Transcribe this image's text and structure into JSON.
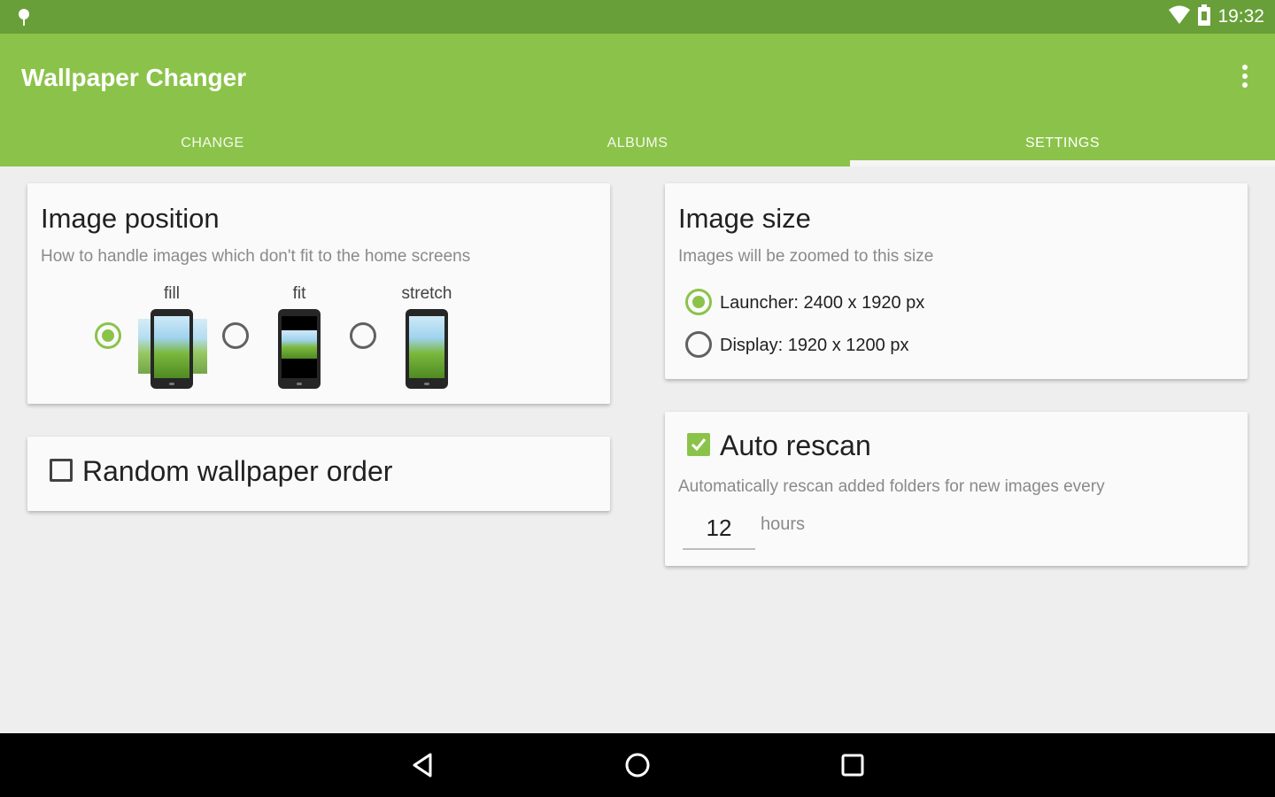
{
  "status_bar": {
    "time": "19:32",
    "icons": [
      "notification-pin-icon",
      "wifi-icon",
      "battery-icon"
    ]
  },
  "app_bar": {
    "title": "Wallpaper Changer",
    "menu_icon": "overflow-menu-icon"
  },
  "tabs": [
    {
      "label": "CHANGE",
      "active": false
    },
    {
      "label": "ALBUMS",
      "active": false
    },
    {
      "label": "SETTINGS",
      "active": true
    }
  ],
  "image_position": {
    "title": "Image position",
    "subtitle": "How to handle images which don't fit to the home screens",
    "options": [
      {
        "label": "fill",
        "selected": true
      },
      {
        "label": "fit",
        "selected": false
      },
      {
        "label": "stretch",
        "selected": false
      }
    ]
  },
  "random_order": {
    "label": "Random wallpaper order",
    "checked": false
  },
  "image_size": {
    "title": "Image size",
    "subtitle": "Images will be zoomed to this size",
    "options": [
      {
        "label": "Launcher: 2400 x 1920 px",
        "selected": true
      },
      {
        "label": "Display: 1920 x 1200 px",
        "selected": false
      }
    ]
  },
  "auto_rescan": {
    "label": "Auto rescan",
    "checked": true,
    "subtitle": "Automatically rescan added folders for new images every",
    "interval_value": "12",
    "interval_unit": "hours"
  },
  "nav_bar": {
    "icons": [
      "back-icon",
      "home-icon",
      "recents-icon"
    ]
  },
  "colors": {
    "primary": "#8bc34a",
    "primary_dark": "#689f38",
    "background": "#eeeeee",
    "card": "#fafafa"
  }
}
